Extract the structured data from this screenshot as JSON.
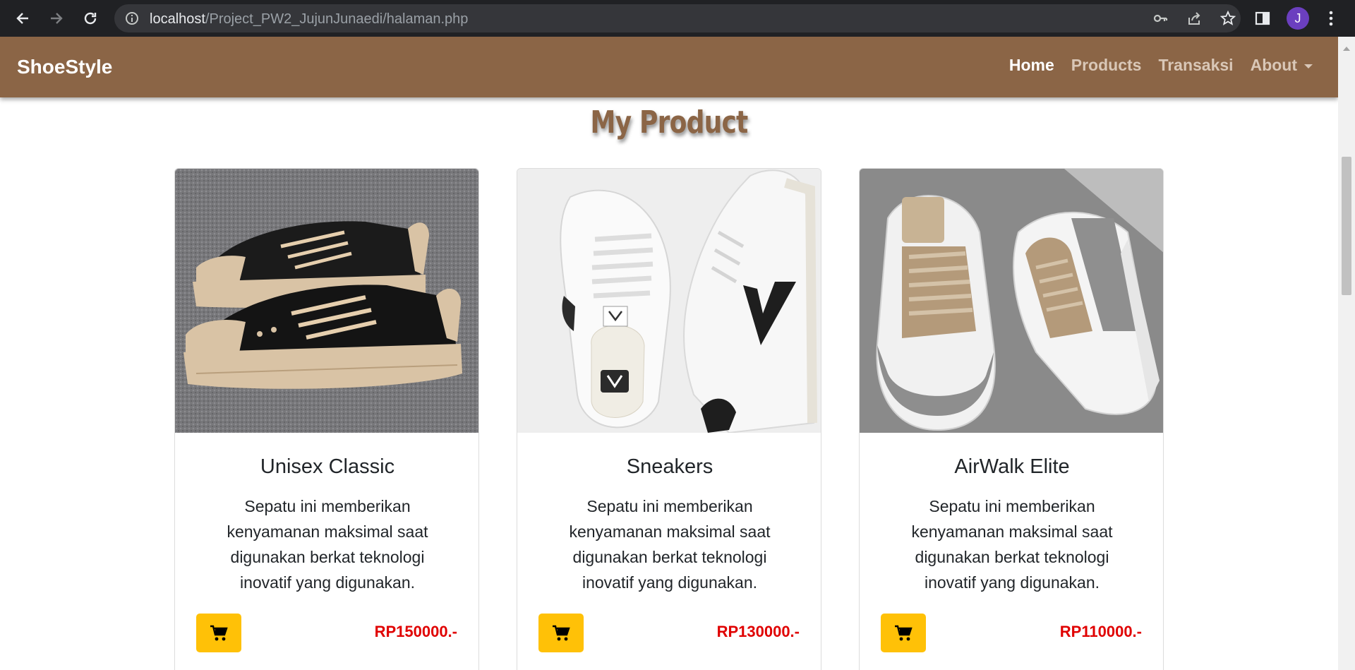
{
  "browser": {
    "url_host": "localhost",
    "url_path": "/Project_PW2_JujunJunaedi/halaman.php",
    "profile_initial": "J"
  },
  "navbar": {
    "brand": "ShoeStyle",
    "links": [
      {
        "label": "Home",
        "active": true
      },
      {
        "label": "Products",
        "active": false
      },
      {
        "label": "Transaksi",
        "active": false
      },
      {
        "label": "About",
        "active": false
      }
    ]
  },
  "section": {
    "title": "My Product"
  },
  "products": [
    {
      "name": "Unisex Classic",
      "description": "Sepatu ini memberikan kenyamanan maksimal saat digunakan berkat teknologi inovatif yang digunakan.",
      "price": "RP150000.-",
      "image": "black-canvas-sneakers"
    },
    {
      "name": "Sneakers",
      "description": "Sepatu ini memberikan kenyamanan maksimal saat digunakan berkat teknologi inovatif yang digunakan.",
      "price": "RP130000.-",
      "image": "white-leather-sneakers"
    },
    {
      "name": "AirWalk Elite",
      "description": "Sepatu ini memberikan kenyamanan maksimal saat digunakan berkat teknologi inovatif yang digunakan.",
      "price": "RP110000.-",
      "image": "grey-chunky-sneakers"
    }
  ],
  "colors": {
    "navbar": "#8b6546",
    "accent_button": "#ffc107",
    "price": "#e00000"
  }
}
